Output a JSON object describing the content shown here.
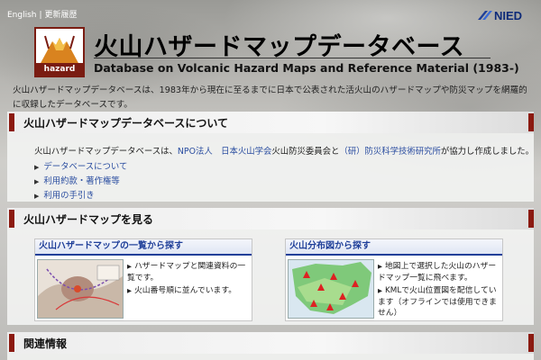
{
  "topnav": {
    "english": "English",
    "separator": "|",
    "history": "更新履歴"
  },
  "brand": {
    "nied": "NIED",
    "logo_text": "hazard"
  },
  "header": {
    "title_jp": "火山ハザードマップデータベース",
    "title_en": "Database on Volcanic Hazard Maps and Reference Material (1983-)"
  },
  "intro": "火山ハザードマップデータベースは、1983年から現在に至るまでに日本で公表された活火山のハザードマップや防災マップを網羅的に収録したデータベースです。",
  "about": {
    "title": "火山ハザードマップデータベースについて",
    "lead_pre": "火山ハザードマップデータベースは、",
    "lead_link1": "NPO法人　日本火山学会",
    "lead_mid": "火山防災委員会と",
    "lead_link2": "（研）防災科学技術研究所",
    "lead_post": "が協力し作成しました。",
    "links": [
      "データベースについて",
      "利用約款・著作権等",
      "利用の手引き"
    ]
  },
  "view": {
    "title": "火山ハザードマップを見る",
    "cards": [
      {
        "title": "火山ハザードマップの一覧から探す",
        "items": [
          "ハザードマップと関連資料の一覧です。",
          "火山番号順に並んでいます。"
        ]
      },
      {
        "title": "火山分布図から探す",
        "items": [
          "地図上で選択した火山のハザードマップ一覧に飛べます。",
          "KMLで火山位置図を配信しています（オフラインでは使用できません）"
        ]
      }
    ]
  },
  "related": {
    "title": "関連情報"
  },
  "colors": {
    "accent_red": "#8b1a10",
    "link_blue": "#2a4da0",
    "card_blue": "#1f3f99"
  }
}
